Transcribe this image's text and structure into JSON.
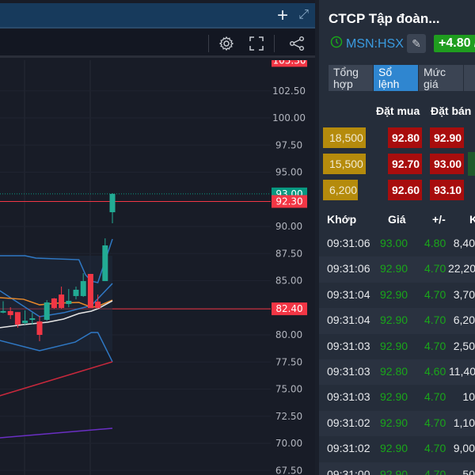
{
  "header": {
    "add_icon": "plus-icon",
    "expand_icon": "expand-icon"
  },
  "toolbar": {
    "icons": [
      "gear-icon",
      "fullscreen-icon",
      "share-icon"
    ]
  },
  "chart_data": {
    "type": "candlestick",
    "yticks": [
      102.5,
      100,
      97.5,
      95,
      90,
      87.5,
      85,
      80,
      77.5,
      75,
      72.5,
      70,
      67.5
    ],
    "ytick_labels": [
      "102.50",
      "100.00",
      "97.50",
      "95.00",
      "90.00",
      "87.50",
      "85.00",
      "80.00",
      "77.50",
      "75.00",
      "72.50",
      "70.00",
      "67.50"
    ],
    "ylim": [
      67.0,
      105.5
    ],
    "price_labels": [
      {
        "label": "105.30",
        "value": 105.3,
        "color": "#f23645"
      },
      {
        "label": "93.00",
        "value": 93.0,
        "color": "#089981"
      },
      {
        "label": "92.30",
        "value": 92.3,
        "color": "#f23645"
      },
      {
        "label": "82.40",
        "value": 82.4,
        "color": "#f23645"
      }
    ],
    "candles": [
      {
        "o": 82.1,
        "h": 83.1,
        "l": 82.0,
        "c": 82.2
      },
      {
        "o": 82.2,
        "h": 82.55,
        "l": 81.46,
        "c": 81.82
      },
      {
        "o": 82.1,
        "h": 82.1,
        "l": 80.66,
        "c": 80.95
      },
      {
        "o": 81.09,
        "h": 82.26,
        "l": 80.95,
        "c": 81.31
      },
      {
        "o": 81.45,
        "h": 82.04,
        "l": 80.95,
        "c": 81.53
      },
      {
        "o": 81.24,
        "h": 81.75,
        "l": 79.42,
        "c": 80.0
      },
      {
        "o": 81.39,
        "h": 83.2,
        "l": 81.3,
        "c": 82.99
      },
      {
        "o": 83.36,
        "h": 83.4,
        "l": 82.4,
        "c": 82.48
      },
      {
        "o": 83.72,
        "h": 84.45,
        "l": 82.4,
        "c": 82.48
      },
      {
        "o": 82.85,
        "h": 84.23,
        "l": 82.55,
        "c": 83.14
      },
      {
        "o": 83.58,
        "h": 84.45,
        "l": 83.28,
        "c": 84.16
      },
      {
        "o": 83.58,
        "h": 85.69,
        "l": 83.5,
        "c": 84.96
      },
      {
        "o": 85.62,
        "h": 85.62,
        "l": 82.48,
        "c": 82.48
      },
      {
        "o": 83.07,
        "h": 83.72,
        "l": 82.41,
        "c": 82.48
      },
      {
        "o": 84.96,
        "h": 88.9,
        "l": 84.96,
        "c": 88.25
      },
      {
        "o": 91.31,
        "h": 93.07,
        "l": 90.29,
        "c": 93.0
      }
    ],
    "lines": [
      {
        "name": "bb-upper",
        "color": "#2f78c4",
        "points": [
          [
            -0.5,
            87.3
          ],
          [
            3,
            87.3
          ],
          [
            4.5,
            87.08
          ],
          [
            10.4,
            86.93
          ],
          [
            11.3,
            85.55
          ],
          [
            12.1,
            84.96
          ],
          [
            13,
            84.82
          ],
          [
            15,
            88.83
          ]
        ]
      },
      {
        "name": "bb-middle",
        "color": "#2f78c4",
        "points": [
          [
            -0.5,
            84.09
          ],
          [
            5,
            81.68
          ],
          [
            8.3,
            82.04
          ],
          [
            10.4,
            82.41
          ],
          [
            12.1,
            82.7
          ],
          [
            15,
            84.74
          ]
        ]
      },
      {
        "name": "bb-lower",
        "color": "#2f78c4",
        "points": [
          [
            -0.5,
            79.49
          ],
          [
            5,
            78.54
          ],
          [
            9.9,
            79.34
          ],
          [
            12.1,
            80.22
          ],
          [
            13,
            80.22
          ],
          [
            15,
            77.52
          ]
        ]
      },
      {
        "name": "ma-orange",
        "color": "#e8892a",
        "points": [
          [
            -0.5,
            83.43
          ],
          [
            2.8,
            83.28
          ],
          [
            5,
            82.77
          ],
          [
            7.2,
            82.92
          ],
          [
            10.4,
            82.99
          ],
          [
            12.1,
            82.55
          ],
          [
            13,
            82.63
          ],
          [
            15,
            83.21
          ]
        ]
      },
      {
        "name": "ma-white",
        "color": "#e6e6e6",
        "points": [
          [
            -0.5,
            80.66
          ],
          [
            2.8,
            80.95
          ],
          [
            6.1,
            81.17
          ],
          [
            8.3,
            81.46
          ],
          [
            10.4,
            81.97
          ],
          [
            12.1,
            82.19
          ],
          [
            13,
            82.41
          ],
          [
            15,
            83.14
          ]
        ]
      },
      {
        "name": "ma-red",
        "color": "#c8283c",
        "points": [
          [
            -0.5,
            74.38
          ],
          [
            15,
            77.52
          ]
        ]
      },
      {
        "name": "ma-purple",
        "color": "#6a2fc4",
        "points": [
          [
            -0.5,
            70.51
          ],
          [
            15,
            71.39
          ]
        ]
      }
    ]
  },
  "panel": {
    "title": "CTCP Tập đoàn...",
    "symbol": "MSN:HSX",
    "change_badge": "+4.80 /",
    "tabs": [
      {
        "label": "Tổng hợp"
      },
      {
        "label": "Sổ lệnh"
      },
      {
        "label": "Mức giá"
      },
      {
        "label": ""
      }
    ],
    "orderbook": {
      "bid_header": "Đặt mua",
      "ask_header": "Đặt bán",
      "rows": [
        {
          "qty": "18,500",
          "bid": "92.80",
          "ask": "92.90"
        },
        {
          "qty": "15,500",
          "bid": "92.70",
          "ask": "93.00"
        },
        {
          "qty": "6,200",
          "bid": "92.60",
          "ask": "93.10"
        }
      ]
    },
    "trades": {
      "headers": {
        "time": "Khớp",
        "price": "Giá",
        "change": "+/-",
        "volume": "K"
      },
      "rows": [
        {
          "time": "09:31:06",
          "price": "93.00",
          "change": "4.80",
          "volume": "8,40"
        },
        {
          "time": "09:31:06",
          "price": "92.90",
          "change": "4.70",
          "volume": "22,20"
        },
        {
          "time": "09:31:04",
          "price": "92.90",
          "change": "4.70",
          "volume": "3,70"
        },
        {
          "time": "09:31:04",
          "price": "92.90",
          "change": "4.70",
          "volume": "6,20"
        },
        {
          "time": "09:31:03",
          "price": "92.90",
          "change": "4.70",
          "volume": "2,50"
        },
        {
          "time": "09:31:03",
          "price": "92.80",
          "change": "4.60",
          "volume": "11,40"
        },
        {
          "time": "09:31:03",
          "price": "92.90",
          "change": "4.70",
          "volume": "10"
        },
        {
          "time": "09:31:02",
          "price": "92.90",
          "change": "4.70",
          "volume": "1,10"
        },
        {
          "time": "09:31:02",
          "price": "92.90",
          "change": "4.70",
          "volume": "9,00"
        },
        {
          "time": "09:31:00",
          "price": "92.90",
          "change": "4.70",
          "volume": "50"
        }
      ]
    }
  }
}
